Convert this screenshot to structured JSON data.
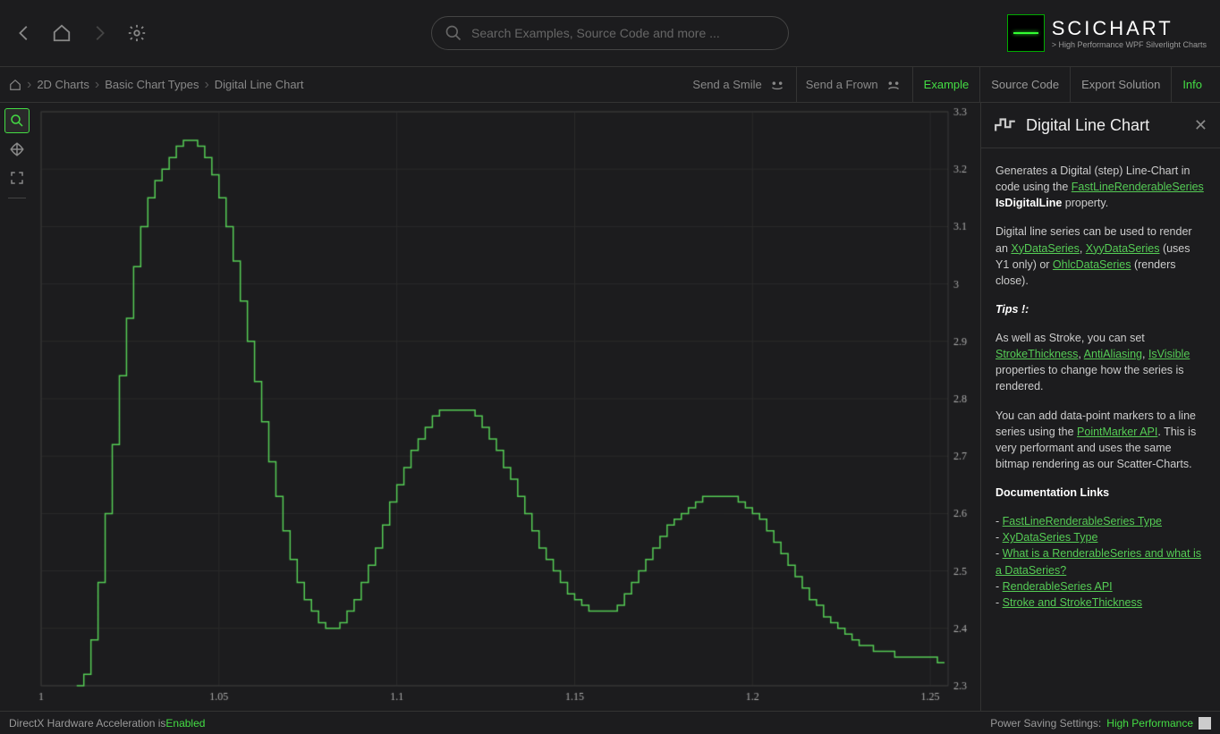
{
  "search": {
    "placeholder": "Search Examples, Source Code and more ..."
  },
  "logo": {
    "name": "SCICHART",
    "tagline": "> High Performance WPF Silverlight Charts"
  },
  "breadcrumb": [
    "2D Charts",
    "Basic Chart Types",
    "Digital Line Chart"
  ],
  "feedback": {
    "smile": "Send a Smile",
    "frown": "Send a Frown"
  },
  "tabs": {
    "example": "Example",
    "source": "Source Code",
    "export": "Export Solution",
    "info": "Info"
  },
  "panel": {
    "title": "Digital Line Chart",
    "p1a": "Generates a Digital (step) Line-Chart in code using the ",
    "p1_link": "FastLineRenderableSeries",
    "p1_bold": "IsDigitalLine",
    "p1b": " property.",
    "p2a": "Digital line series can be used to render an ",
    "p2_l1": "XyDataSeries",
    "p2_l2": "XyyDataSeries",
    "p2_mid": " (uses Y1 only) or ",
    "p2_l3": "OhlcDataSeries",
    "p2_end": " (renders close).",
    "tips": "Tips !:",
    "p3a": "As well as Stroke, you can set ",
    "p3_l1": "StrokeThickness",
    "p3_l2": "AntiAliasing",
    "p3_l3": "IsVisible",
    "p3b": " properties to change how the series is rendered.",
    "p4a": "You can add data-point markers to a line series using the ",
    "p4_l": "PointMarker API",
    "p4b": ". This is very performant and uses the same bitmap rendering as our Scatter-Charts.",
    "docs_heading": "Documentation Links",
    "docs": [
      "FastLineRenderableSeries Type",
      "XyDataSeries Type",
      "What is a RenderableSeries and what is a DataSeries?",
      "RenderableSeries API",
      "Stroke and StrokeThickness"
    ]
  },
  "status": {
    "directx": "DirectX Hardware Acceleration is ",
    "directx_state": "Enabled",
    "power_label": "Power Saving Settings: ",
    "power_value": "High Performance"
  },
  "chart_data": {
    "type": "line",
    "digital_step": true,
    "stroke": "#55cc55",
    "xlim": [
      1.0,
      1.255
    ],
    "ylim": [
      2.3,
      3.3
    ],
    "x_ticks": [
      1.0,
      1.05,
      1.1,
      1.15,
      1.2,
      1.25
    ],
    "x_tick_labels": [
      "1",
      "1.05",
      "1.1",
      "1.15",
      "1.2",
      "1.25"
    ],
    "y_ticks": [
      2.3,
      2.4,
      2.5,
      2.6,
      2.7,
      2.8,
      2.9,
      3.0,
      3.1,
      3.2,
      3.3
    ],
    "x": [
      1.01,
      1.012,
      1.014,
      1.016,
      1.018,
      1.02,
      1.022,
      1.024,
      1.026,
      1.028,
      1.03,
      1.032,
      1.034,
      1.036,
      1.038,
      1.04,
      1.042,
      1.044,
      1.046,
      1.048,
      1.05,
      1.052,
      1.054,
      1.056,
      1.058,
      1.06,
      1.062,
      1.064,
      1.066,
      1.068,
      1.07,
      1.072,
      1.074,
      1.076,
      1.078,
      1.08,
      1.082,
      1.084,
      1.086,
      1.088,
      1.09,
      1.092,
      1.094,
      1.096,
      1.098,
      1.1,
      1.102,
      1.104,
      1.106,
      1.108,
      1.11,
      1.112,
      1.114,
      1.116,
      1.118,
      1.12,
      1.122,
      1.124,
      1.126,
      1.128,
      1.13,
      1.132,
      1.134,
      1.136,
      1.138,
      1.14,
      1.142,
      1.144,
      1.146,
      1.148,
      1.15,
      1.152,
      1.154,
      1.156,
      1.158,
      1.16,
      1.162,
      1.164,
      1.166,
      1.168,
      1.17,
      1.172,
      1.174,
      1.176,
      1.178,
      1.18,
      1.182,
      1.184,
      1.186,
      1.188,
      1.19,
      1.192,
      1.194,
      1.196,
      1.198,
      1.2,
      1.202,
      1.204,
      1.206,
      1.208,
      1.21,
      1.212,
      1.214,
      1.216,
      1.218,
      1.22,
      1.222,
      1.224,
      1.226,
      1.228,
      1.23,
      1.232,
      1.234,
      1.236,
      1.238,
      1.24,
      1.242,
      1.244,
      1.246,
      1.248,
      1.25,
      1.252,
      1.254
    ],
    "values": [
      2.3,
      2.32,
      2.38,
      2.48,
      2.6,
      2.72,
      2.84,
      2.94,
      3.03,
      3.1,
      3.15,
      3.18,
      3.2,
      3.22,
      3.24,
      3.25,
      3.25,
      3.24,
      3.22,
      3.19,
      3.15,
      3.1,
      3.04,
      2.97,
      2.9,
      2.83,
      2.76,
      2.69,
      2.63,
      2.57,
      2.52,
      2.48,
      2.45,
      2.43,
      2.41,
      2.4,
      2.4,
      2.41,
      2.43,
      2.45,
      2.48,
      2.51,
      2.54,
      2.58,
      2.62,
      2.65,
      2.68,
      2.71,
      2.73,
      2.75,
      2.77,
      2.78,
      2.78,
      2.78,
      2.78,
      2.78,
      2.77,
      2.75,
      2.73,
      2.71,
      2.68,
      2.66,
      2.63,
      2.6,
      2.57,
      2.54,
      2.52,
      2.5,
      2.48,
      2.46,
      2.45,
      2.44,
      2.43,
      2.43,
      2.43,
      2.43,
      2.44,
      2.46,
      2.48,
      2.5,
      2.52,
      2.54,
      2.56,
      2.58,
      2.59,
      2.6,
      2.61,
      2.62,
      2.63,
      2.63,
      2.63,
      2.63,
      2.63,
      2.62,
      2.61,
      2.6,
      2.59,
      2.57,
      2.55,
      2.53,
      2.51,
      2.49,
      2.47,
      2.45,
      2.44,
      2.42,
      2.41,
      2.4,
      2.39,
      2.38,
      2.37,
      2.37,
      2.36,
      2.36,
      2.36,
      2.35,
      2.35,
      2.35,
      2.35,
      2.35,
      2.35,
      2.34,
      2.34
    ]
  }
}
